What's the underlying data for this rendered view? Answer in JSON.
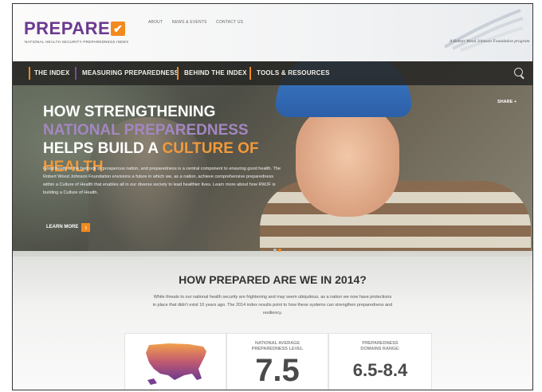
{
  "header": {
    "logo_text": "PREPARE",
    "logo_check": "✔",
    "logo_subtitle": "NATIONAL HEALTH SECURITY PREPAREDNESS INDEX",
    "top_links": [
      "ABOUT",
      "NEWS & EVENTS",
      "CONTACT US"
    ],
    "partner_text": "A Robert Wood Johnson Foundation program"
  },
  "nav": {
    "items": [
      {
        "label": "THE INDEX",
        "accent": "#f28a1e"
      },
      {
        "label": "MEASURING PREPAREDNESS",
        "accent": "#7b4a9c"
      },
      {
        "label": "BEHIND THE INDEX",
        "accent": "#f28a1e"
      },
      {
        "label": "TOOLS & RESOURCES",
        "accent": "#f28a1e"
      }
    ],
    "search_icon": "search-icon"
  },
  "hero": {
    "headline_1": "HOW STRENGTHENING ",
    "headline_2": "NATIONAL PREPAREDNESS",
    "headline_3": " HELPS BUILD A ",
    "headline_4": "CULTURE OF HEALTH",
    "body": "Good health is the bedrock of prosperous nation, and preparedness is a central component to ensuring good health. The Robert Wood Johnson Foundation envisions a future in which we, as a nation, achieve comprehensive preparedness within a Culture of Health that enables all in our diverse society to lead healthier lives. Learn more about how RWJF is building a Culture of Health.",
    "learn_more": "LEARN MORE",
    "share": "SHARE +"
  },
  "section": {
    "title": "HOW PREPARED ARE WE IN 2014?",
    "text": "While threats to our national health security are frightening and may seem ubiquitous, as a nation we now have protections in place that didn't exist 10 years ago. The 2014 index results point to how these systems can strengthen preparedness and resiliency."
  },
  "stats": {
    "national_label": "NATIONAL AVERAGE PREPAREDNESS LEVEL",
    "national_value": "7.5",
    "range_label": "PREPAREDNESS DOMAINS RANGE:",
    "range_value": "6.5-8.4"
  },
  "colors": {
    "brand_purple": "#6b3a8f",
    "accent_orange": "#f28a1e",
    "nav_bg": "#2b2b28"
  }
}
